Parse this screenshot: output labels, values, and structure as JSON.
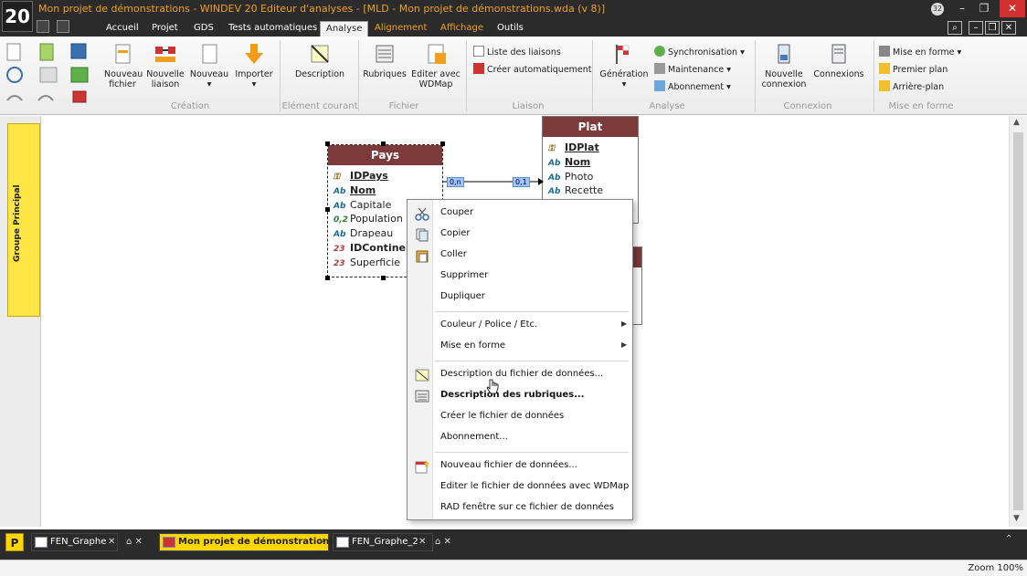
{
  "app": {
    "title": "Mon projet de démonstrations - WINDEV 20  Editeur d'analyses - [MLD - Mon projet de démonstrations.wda (v 8)]",
    "logo": "20",
    "notification_count": "32"
  },
  "menu": {
    "tabs": [
      "Accueil",
      "Projet",
      "GDS",
      "Tests automatiques",
      "Analyse",
      "Alignement",
      "Affichage",
      "Outils"
    ],
    "active": "Analyse"
  },
  "ribbon": {
    "creation": {
      "label": "Création",
      "nouveau_fichier": "Nouveau fichier",
      "nouvelle_liaison": "Nouvelle liaison",
      "nouveau": "Nouveau",
      "importer": "Importer"
    },
    "element_courant": {
      "label": "Elément courant",
      "description": "Description"
    },
    "fichier": {
      "label": "Fichier",
      "rubriques": "Rubriques",
      "editer_wdmap": "Editer avec WDMap"
    },
    "liaison": {
      "label": "Liaison",
      "liste": "Liste des liaisons",
      "creer": "Créer automatiquement"
    },
    "analyse": {
      "label": "Analyse",
      "generation": "Génération",
      "synchronisation": "Synchronisation",
      "maintenance": "Maintenance",
      "abonnement": "Abonnement"
    },
    "connexion": {
      "label": "Connexion",
      "nouvelle": "Nouvelle connexion",
      "connexions": "Connexions"
    },
    "mise_en_forme": {
      "label": "Mise en forme",
      "mise_en_forme": "Mise en forme",
      "premier_plan": "Premier plan",
      "arriere_plan": "Arrière-plan"
    }
  },
  "sidebar": {
    "group_label": "Groupe Principal"
  },
  "entities": {
    "pays": {
      "title": "Pays",
      "fields": [
        {
          "type": "key",
          "name": "IDPays",
          "style": "key"
        },
        {
          "type": "Ab",
          "name": "Nom",
          "style": "key"
        },
        {
          "type": "Ab",
          "name": "Capitale",
          "style": "normal"
        },
        {
          "type": "0,2",
          "name": "Population",
          "style": "normal"
        },
        {
          "type": "Ab",
          "name": "Drapeau",
          "style": "normal"
        },
        {
          "type": "23",
          "name": "IDContinent",
          "style": "bold"
        },
        {
          "type": "23",
          "name": "Superficie",
          "style": "normal"
        }
      ]
    },
    "plat": {
      "title": "Plat",
      "fields": [
        {
          "type": "key",
          "name": "IDPlat",
          "style": "key"
        },
        {
          "type": "Ab",
          "name": "Nom",
          "style": "key"
        },
        {
          "type": "Ab",
          "name": "Photo",
          "style": "normal"
        },
        {
          "type": "Ab",
          "name": "Recette",
          "style": "normal"
        }
      ]
    },
    "relation": {
      "left_card": "0,n",
      "right_card": "0,1"
    }
  },
  "context_menu": {
    "items": [
      "Couper",
      "Copier",
      "Coller",
      "Supprimer",
      "Dupliquer",
      "Couleur / Police / Etc.",
      "Mise en forme",
      "Description du fichier de données...",
      "Description des rubriques...",
      "Créer le fichier de données",
      "Abonnement...",
      "Nouveau fichier de données...",
      "Editer le fichier de données avec WDMap",
      "RAD fenêtre sur ce fichier de données"
    ]
  },
  "tabs": {
    "items": [
      "FEN_Graphe",
      "Mon projet de démonstrations",
      "FEN_Graphe_2"
    ],
    "active": "Mon projet de démonstrations"
  },
  "status": {
    "zoom": "Zoom 100%"
  },
  "colors": {
    "title_orange": "#f0a020",
    "entity_header": "#7c3a3a",
    "group_tab_yellow": "#ffe545",
    "dark_chrome": "#2b2b2b"
  }
}
